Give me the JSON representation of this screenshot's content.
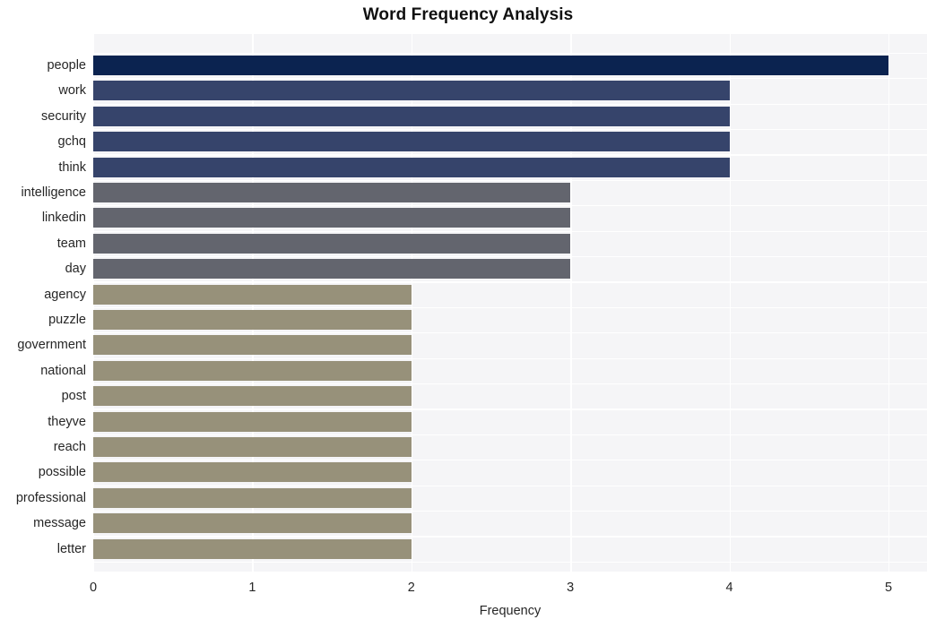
{
  "chart_data": {
    "type": "bar",
    "orientation": "horizontal",
    "title": "Word Frequency Analysis",
    "xlabel": "Frequency",
    "ylabel": "",
    "xlim": [
      0,
      5
    ],
    "xticks": [
      "0",
      "1",
      "2",
      "3",
      "4",
      "5"
    ],
    "grid": true,
    "legend": "none",
    "categories": [
      "people",
      "work",
      "security",
      "gchq",
      "think",
      "intelligence",
      "linkedin",
      "team",
      "day",
      "agency",
      "puzzle",
      "government",
      "national",
      "post",
      "theyve",
      "reach",
      "possible",
      "professional",
      "message",
      "letter"
    ],
    "values": [
      5,
      4,
      4,
      4,
      4,
      3,
      3,
      3,
      3,
      2,
      2,
      2,
      2,
      2,
      2,
      2,
      2,
      2,
      2,
      2
    ],
    "bar_colors": [
      "#0b2350",
      "#36446b",
      "#36446b",
      "#36446b",
      "#36446b",
      "#63656e",
      "#63656e",
      "#63656e",
      "#63656e",
      "#97917a",
      "#97917a",
      "#97917a",
      "#97917a",
      "#97917a",
      "#97917a",
      "#97917a",
      "#97917a",
      "#97917a",
      "#97917a",
      "#97917a"
    ],
    "colors": {
      "panel_background": "#f5f5f7",
      "figure_background": "#ffffff",
      "gridline": "#ffffff",
      "text": "#262626",
      "title": "#111111"
    }
  }
}
